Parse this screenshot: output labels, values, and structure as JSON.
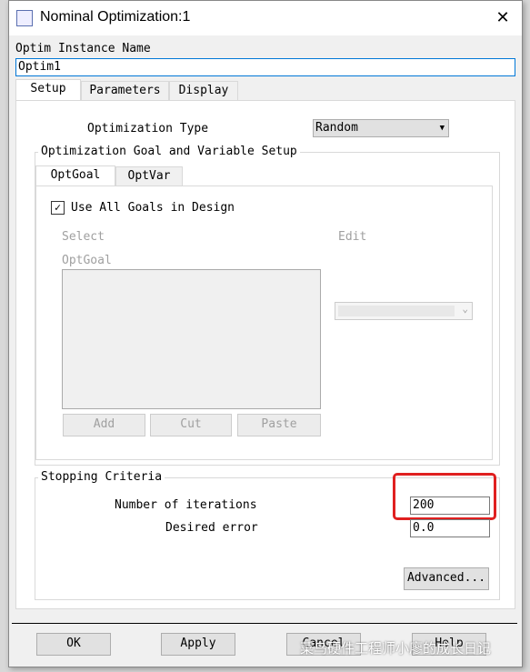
{
  "window": {
    "title": "Nominal Optimization:1",
    "close_icon": "close-icon",
    "app_icon": "optim-icon"
  },
  "instance": {
    "label": "Optim Instance Name",
    "value": "Optim1"
  },
  "tabs": [
    {
      "label": "Setup",
      "active": true
    },
    {
      "label": "Parameters"
    },
    {
      "label": "Display"
    }
  ],
  "setup": {
    "opt_type_label": "Optimization Type",
    "opt_type_value": "Random",
    "goal_group_title": "Optimization Goal and Variable Setup",
    "subtabs": [
      {
        "label": "OptGoal",
        "active": true
      },
      {
        "label": "OptVar"
      }
    ],
    "use_all_goals": {
      "label": "Use All Goals in Design",
      "checked": true
    },
    "select_label": "Select",
    "edit_label": "Edit",
    "list_label": "OptGoal",
    "add": "Add",
    "cut": "Cut",
    "paste": "Paste",
    "stop_group_title": "Stopping Criteria",
    "iterations_label": "Number of iterations",
    "iterations_value": "200",
    "error_label": "Desired error",
    "error_value": "0.0",
    "advanced": "Advanced...",
    "highlight_color": "#e02020"
  },
  "footer": {
    "ok": "OK",
    "apply": "Apply",
    "cancel": "Cancel",
    "help": "Help"
  },
  "watermark": "菜鸟硬件工程师小廖的成长日记"
}
